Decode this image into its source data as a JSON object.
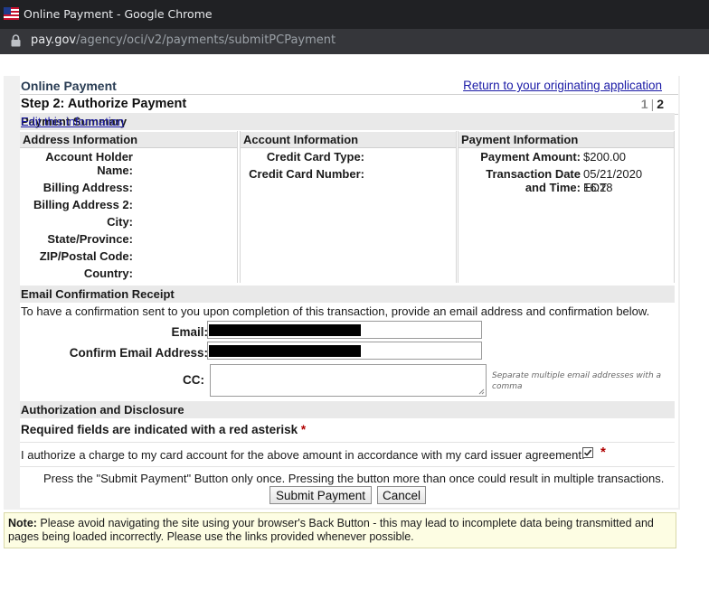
{
  "browser": {
    "window_title": "Online Payment - Google Chrome",
    "url_host": "pay.gov",
    "url_path": "/agency/oci/v2/payments/submitPCPayment"
  },
  "header": {
    "title": "Online Payment",
    "return_link": "Return to your originating application",
    "step_title": "Step 2: Authorize Payment",
    "step_prev": "1",
    "step_sep": "|",
    "step_current": "2"
  },
  "summary": {
    "heading": "Payment Summary",
    "edit_link": "Edit this information"
  },
  "address": {
    "heading": "Address Information",
    "labels": {
      "holder_1": "Account Holder",
      "holder_2": "Name:",
      "billing": "Billing Address:",
      "billing2": "Billing Address 2:",
      "city": "City:",
      "state": "State/Province:",
      "zip": "ZIP/Postal Code:",
      "country": "Country:"
    }
  },
  "account": {
    "heading": "Account Information",
    "labels": {
      "card_type": "Credit Card Type:",
      "card_number": "Credit Card Number:"
    }
  },
  "payment": {
    "heading": "Payment Information",
    "amount_label": "Payment Amount:",
    "amount_value": "$200.00",
    "date_label_1": "Transaction Date",
    "date_label_2": "and Time:",
    "date_value_1": "05/21/2020 16:28",
    "date_value_2": "EDT"
  },
  "email": {
    "heading": "Email Confirmation Receipt",
    "description": "To have a confirmation sent to you upon completion of this transaction, provide an email address and confirmation below.",
    "email_label": "Email:",
    "confirm_label": "Confirm Email Address:",
    "cc_label": "CC:",
    "cc_hint": "Separate multiple email addresses with a comma"
  },
  "authorization": {
    "heading": "Authorization and Disclosure",
    "required_text": "Required fields are indicated with a red asterisk",
    "asterisk": "*",
    "authorize_text": "I authorize a charge to my card account for the above amount in accordance with my card issuer agreement.",
    "authorize_checked": true,
    "press_note": "Press the \"Submit Payment\" Button only once. Pressing the button more than once could result in multiple transactions.",
    "submit_button": "Submit Payment",
    "cancel_button": "Cancel"
  },
  "note": {
    "label": "Note:",
    "text": " Please avoid navigating the site using your browser's Back Button - this may lead to incomplete data being transmitted and pages being loaded incorrectly. Please use the links provided whenever possible."
  },
  "colors": {
    "link": "#1a1aa6",
    "asterisk": "#b00000",
    "section_bar": "#e9e9e9",
    "note_bg": "#fdfde3"
  }
}
